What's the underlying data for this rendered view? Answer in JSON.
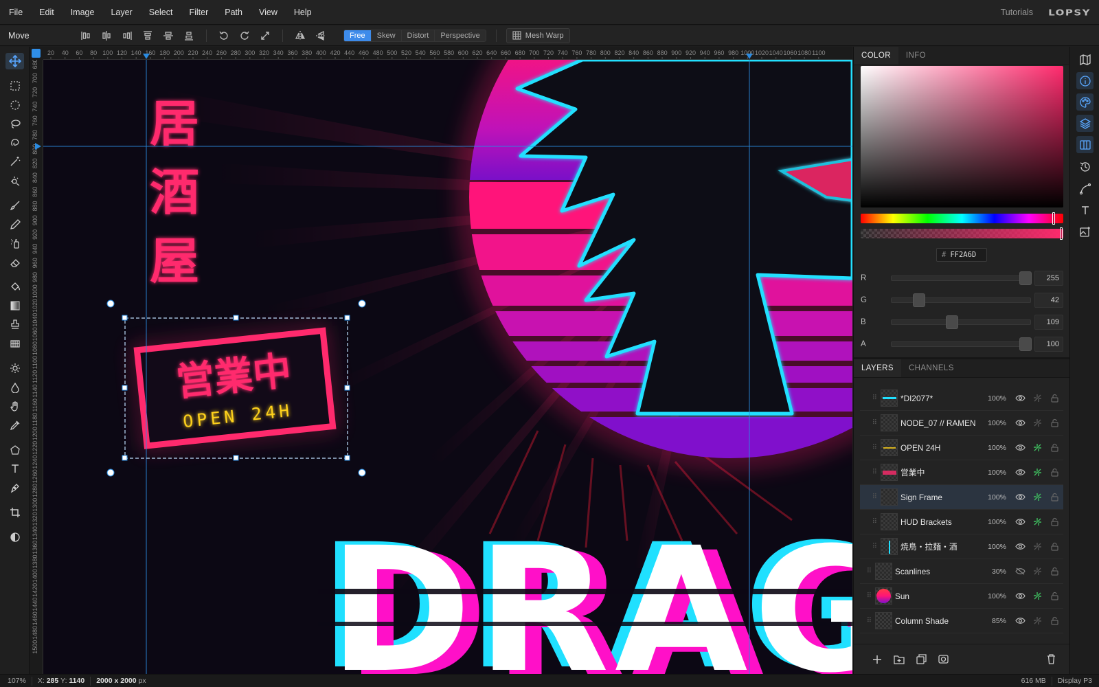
{
  "app": {
    "brand": "LOPSY",
    "tutorials": "Tutorials"
  },
  "menu": [
    "File",
    "Edit",
    "Image",
    "Layer",
    "Select",
    "Filter",
    "Path",
    "View",
    "Help"
  ],
  "options": {
    "tool_name": "Move",
    "transform_modes": [
      "Free",
      "Skew",
      "Distort",
      "Perspective"
    ],
    "active_mode": "Free",
    "mesh_warp": "Mesh Warp"
  },
  "rulers": {
    "top": [
      "20",
      "40",
      "60",
      "80",
      "100",
      "120",
      "140",
      "160",
      "180",
      "200",
      "220",
      "240",
      "260",
      "280",
      "300",
      "320",
      "340",
      "360",
      "380",
      "400",
      "420",
      "440",
      "460",
      "480",
      "500",
      "520",
      "540",
      "560",
      "580",
      "600",
      "620",
      "640",
      "660",
      "680",
      "700",
      "720",
      "740",
      "760",
      "780",
      "800",
      "820",
      "840",
      "860",
      "880",
      "900",
      "920",
      "940",
      "960",
      "980",
      "1000",
      "1020",
      "1040",
      "1060",
      "1080",
      "1100"
    ],
    "left": [
      "680",
      "700",
      "720",
      "740",
      "760",
      "780",
      "800",
      "820",
      "840",
      "860",
      "880",
      "900",
      "920",
      "940",
      "960",
      "980",
      "1000",
      "1020",
      "1040",
      "1060",
      "1080",
      "1100",
      "1120",
      "1140",
      "1160",
      "1180",
      "1200",
      "1220",
      "1240",
      "1260",
      "1280",
      "1300",
      "1320",
      "1340",
      "1360",
      "1380",
      "1400",
      "1420",
      "1440",
      "1460",
      "1480",
      "1500"
    ]
  },
  "artwork": {
    "vertical_kanji": [
      "居",
      "酒",
      "屋"
    ],
    "sign_kanji": "営業中",
    "sign_sub": "OPEN 24H",
    "big_word": "DRAG",
    "colors": {
      "neon_pink": "#ff2a6d",
      "neon_cyan": "#20e0ff",
      "neon_yellow": "#ffd21a",
      "purple": "#8a12c8",
      "bg": "#0c0814"
    }
  },
  "color_panel": {
    "tabs": [
      "COLOR",
      "INFO"
    ],
    "hex_label": "#",
    "hex": "FF2A6D",
    "channels": [
      {
        "label": "R",
        "value": "255",
        "frac": 1.0
      },
      {
        "label": "G",
        "value": "42",
        "frac": 0.165
      },
      {
        "label": "B",
        "value": "109",
        "frac": 0.427
      },
      {
        "label": "A",
        "value": "100",
        "frac": 1.0
      }
    ]
  },
  "layers_panel": {
    "tabs": [
      "LAYERS",
      "CHANNELS"
    ],
    "layers": [
      {
        "name": "*DI2077*",
        "opacity": "100%",
        "visible": true,
        "linked": false,
        "selected": false
      },
      {
        "name": "NODE_07 // RAMEN",
        "opacity": "100%",
        "visible": true,
        "linked": false,
        "selected": false
      },
      {
        "name": "OPEN 24H",
        "opacity": "100%",
        "visible": true,
        "linked": true,
        "selected": false
      },
      {
        "name": "営業中",
        "opacity": "100%",
        "visible": true,
        "linked": true,
        "selected": false
      },
      {
        "name": "Sign Frame",
        "opacity": "100%",
        "visible": true,
        "linked": true,
        "selected": true
      },
      {
        "name": "HUD Brackets",
        "opacity": "100%",
        "visible": true,
        "linked": true,
        "selected": false
      },
      {
        "name": "焼鳥・拉麺・酒",
        "opacity": "100%",
        "visible": true,
        "linked": false,
        "selected": false
      },
      {
        "name": "Scanlines",
        "opacity": "30%",
        "visible": false,
        "linked": false,
        "selected": false
      },
      {
        "name": "Sun",
        "opacity": "100%",
        "visible": true,
        "linked": true,
        "selected": false
      },
      {
        "name": "Column Shade",
        "opacity": "85%",
        "visible": true,
        "linked": false,
        "selected": false
      }
    ]
  },
  "status": {
    "zoom": "107%",
    "x_label": "X:",
    "x": "285",
    "y_label": "Y:",
    "y": "1140",
    "doc_size": "2000 x 2000",
    "doc_unit": "px",
    "memory": "616 MB",
    "color_profile": "Display P3"
  }
}
